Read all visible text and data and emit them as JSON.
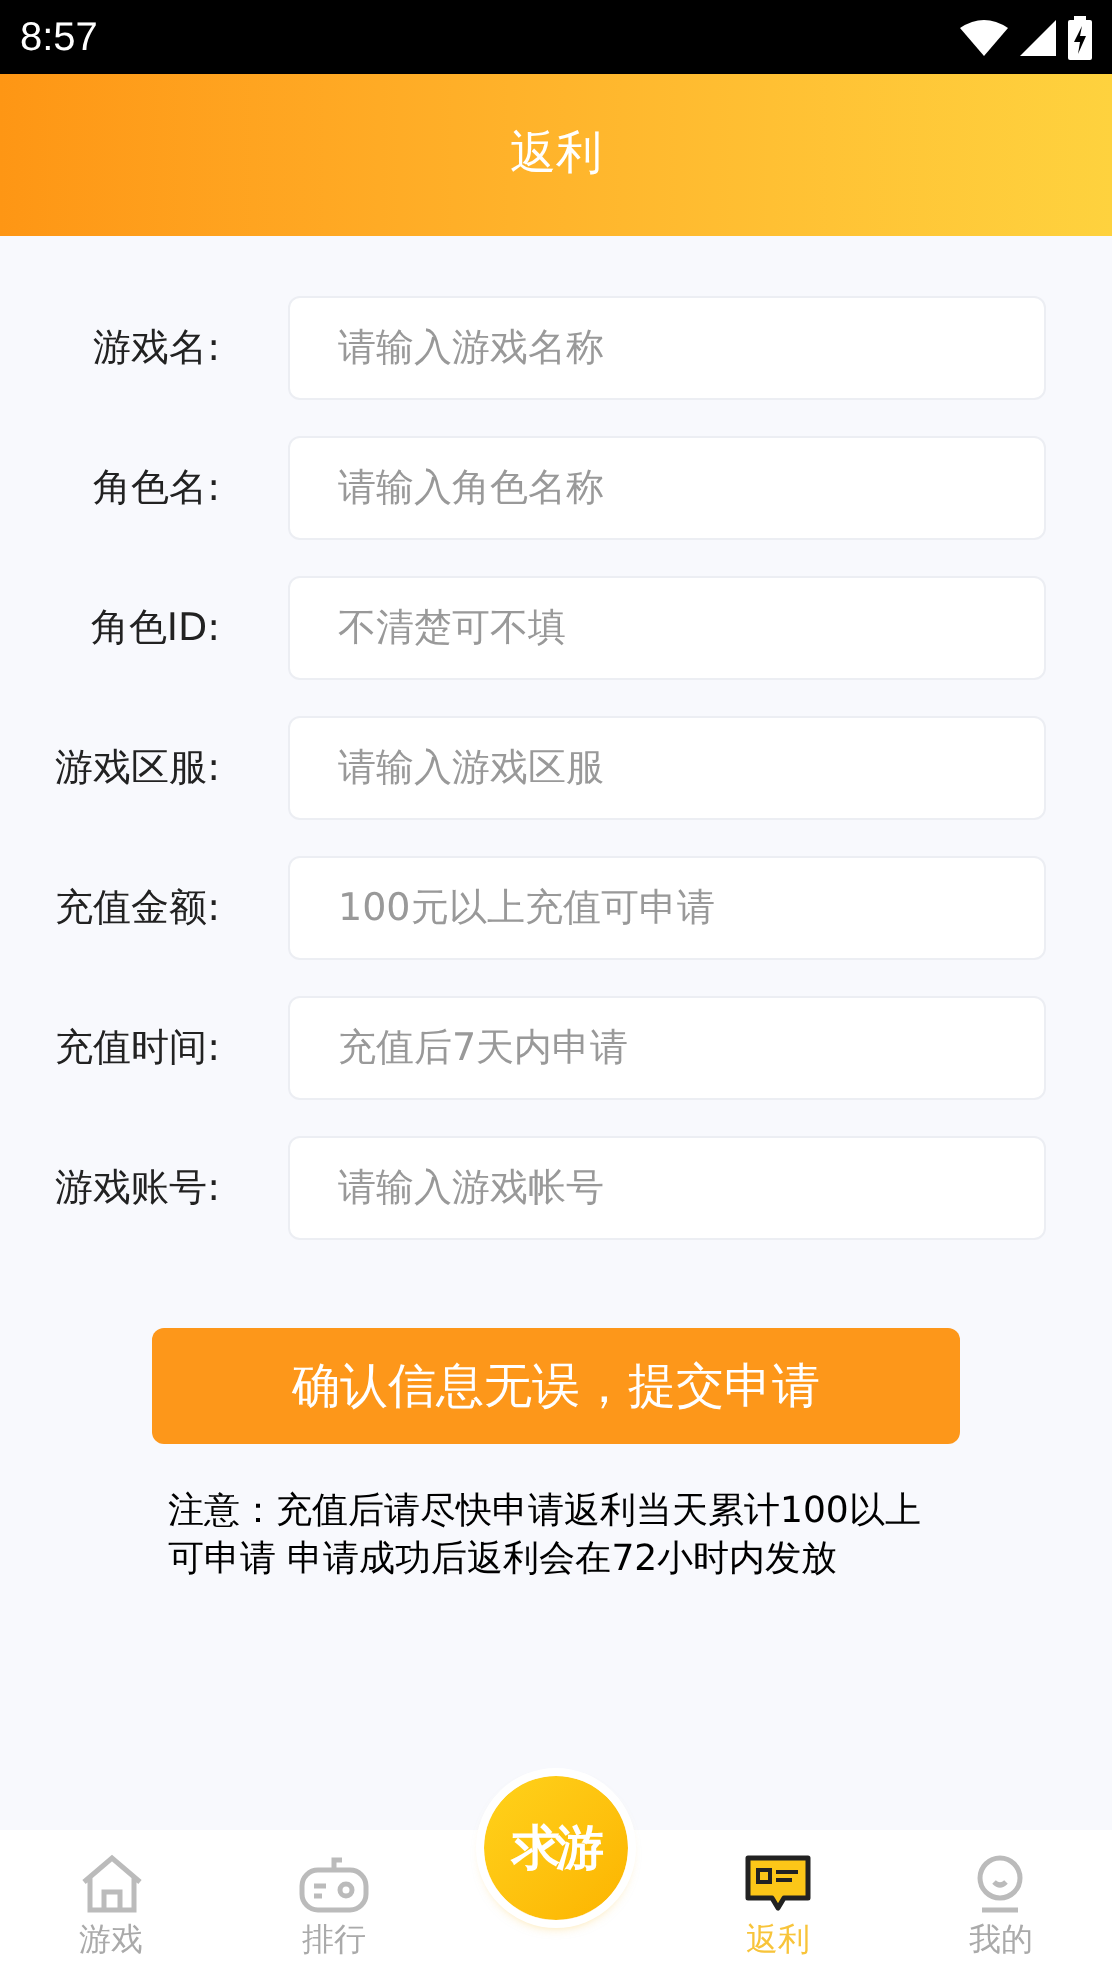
{
  "status_bar": {
    "time": "8:57"
  },
  "header": {
    "title": "返利"
  },
  "form": {
    "fields": [
      {
        "label": "游戏名:",
        "placeholder": "请输入游戏名称"
      },
      {
        "label": "角色名:",
        "placeholder": "请输入角色名称"
      },
      {
        "label": "角色ID:",
        "placeholder": "不清楚可不填"
      },
      {
        "label": "游戏区服:",
        "placeholder": "请输入游戏区服"
      },
      {
        "label": "充值金额:",
        "placeholder": "100元以上充值可申请"
      },
      {
        "label": "充值时间:",
        "placeholder": "充值后7天内申请"
      },
      {
        "label": "游戏账号:",
        "placeholder": "请输入游戏帐号"
      }
    ]
  },
  "submit_button": "确认信息无误，提交申请",
  "note": "注意：充值后请尽快申请返利当天累计100以上可申请 申请成功后返利会在72小时内发放",
  "bottom_nav": {
    "center_logo": "求游",
    "items": [
      {
        "kind": "home",
        "label": "游戏",
        "selected": false
      },
      {
        "kind": "gamepad",
        "label": "排行",
        "selected": false
      },
      {
        "kind": "center"
      },
      {
        "kind": "ticket",
        "label": "返利",
        "selected": true
      },
      {
        "kind": "user",
        "label": "我的",
        "selected": false
      }
    ]
  }
}
